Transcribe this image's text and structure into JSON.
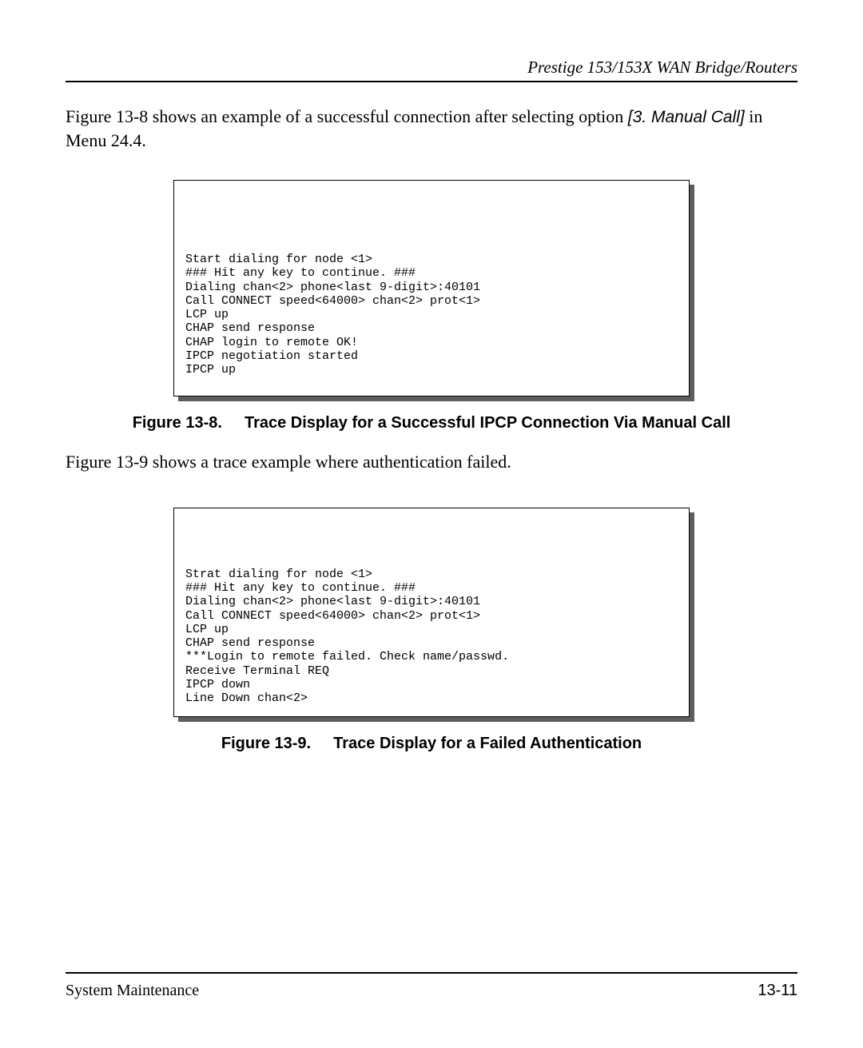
{
  "header": "Prestige 153/153X  WAN Bridge/Routers",
  "para1_a": "Figure 13-8 shows an example of a successful connection after selecting option ",
  "para1_ref": "[3. Manual Call]",
  "para1_b": " in Menu 24.4.",
  "code1": "Start dialing for node <1>\n### Hit any key to continue. ###\nDialing chan<2> phone<last 9-digit>:40101\nCall CONNECT speed<64000> chan<2> prot<1>\nLCP up\nCHAP send response\nCHAP login to remote OK!\nIPCP negotiation started\nIPCP up",
  "caption1_num": "Figure 13-8.",
  "caption1_text": "Trace Display for a Successful IPCP Connection Via Manual Call",
  "para2": "Figure 13-9 shows a trace example where authentication failed.",
  "code2": "Strat dialing for node <1>\n### Hit any key to continue. ###\nDialing chan<2> phone<last 9-digit>:40101\nCall CONNECT speed<64000> chan<2> prot<1>\nLCP up\nCHAP send response\n***Login to remote failed. Check name/passwd.\nReceive Terminal REQ\nIPCP down\nLine Down chan<2>",
  "caption2_num": "Figure 13-9.",
  "caption2_text": "Trace Display for a Failed Authentication",
  "footer_left": "System Maintenance",
  "footer_right": "13-11"
}
